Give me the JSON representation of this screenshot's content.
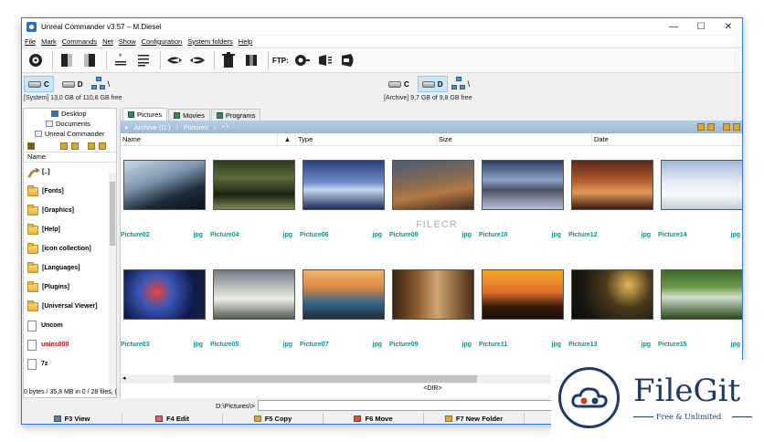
{
  "window": {
    "title": "Unreal Commander v3.57 – M.Diesel",
    "controls": [
      "—",
      "☐",
      "✕"
    ]
  },
  "menu": [
    "File",
    "Mark",
    "Commands",
    "Net",
    "Show",
    "Configuration",
    "System folders",
    "Help"
  ],
  "toolbar": {
    "ftp_label": "FTP:"
  },
  "left_drives": {
    "buttons": [
      {
        "letter": "C",
        "active": true
      },
      {
        "letter": "D",
        "active": false
      }
    ],
    "root": "\\",
    "info": "[System]  13,0 GB of  110,8 GB free"
  },
  "right_drives": {
    "buttons": [
      {
        "letter": "C",
        "active": false
      },
      {
        "letter": "D",
        "active": true
      }
    ],
    "root": "\\",
    "info": "[Archive]  9,7 GB of  9,8 GB free"
  },
  "left_panel": {
    "tree": [
      "Desktop",
      "Documents",
      "Unreal Commander"
    ],
    "header": "Name",
    "items": [
      {
        "name": "[..]",
        "type": "up"
      },
      {
        "name": "[Fonts]",
        "type": "folder"
      },
      {
        "name": "[Graphics]",
        "type": "folder"
      },
      {
        "name": "[Help]",
        "type": "folder"
      },
      {
        "name": "[icon collection]",
        "type": "folder"
      },
      {
        "name": "[Languages]",
        "type": "folder"
      },
      {
        "name": "[Plugins]",
        "type": "folder"
      },
      {
        "name": "[Universal Viewer]",
        "type": "folder"
      },
      {
        "name": "Uncom",
        "type": "file"
      },
      {
        "name": "unins000",
        "type": "file",
        "color": "#b0141e"
      },
      {
        "name": "7z",
        "type": "file"
      }
    ],
    "status": "0 bytes / 35,8 MB in 0 / 28 files, ("
  },
  "right_panel": {
    "tabs": [
      "Pictures",
      "Movies",
      "Programs"
    ],
    "path": [
      "Archive (D:)",
      "Pictures",
      "*.*"
    ],
    "columns": [
      "Name",
      "Type",
      "Size",
      "Date"
    ],
    "thumbnails": [
      {
        "name": "Picture02",
        "ext": "jpg"
      },
      {
        "name": "Picture04",
        "ext": "jpg"
      },
      {
        "name": "Picture06",
        "ext": "jpg"
      },
      {
        "name": "Picture08",
        "ext": "jpg"
      },
      {
        "name": "Picture10",
        "ext": "jpg"
      },
      {
        "name": "Picture12",
        "ext": "jpg"
      },
      {
        "name": "Picture14",
        "ext": "jpg"
      },
      {
        "name": "Picture03",
        "ext": "jpg"
      },
      {
        "name": "Picture05",
        "ext": "jpg"
      },
      {
        "name": "Picture07",
        "ext": "jpg"
      },
      {
        "name": "Picture09",
        "ext": "jpg"
      },
      {
        "name": "Picture11",
        "ext": "jpg"
      },
      {
        "name": "Picture13",
        "ext": "jpg"
      },
      {
        "name": "Picture15",
        "ext": "jpg"
      }
    ],
    "status": "<DIR>"
  },
  "cmdline": {
    "prompt": "D:\\Pictures\\>",
    "value": ""
  },
  "fkeys": [
    "F3 View",
    "F4 Edit",
    "F5 Copy",
    "F6 Move",
    "F7 New Folder"
  ],
  "watermark": "FILECR",
  "badge": {
    "title": "FileGit",
    "subtitle": "Free & Unlimited"
  }
}
